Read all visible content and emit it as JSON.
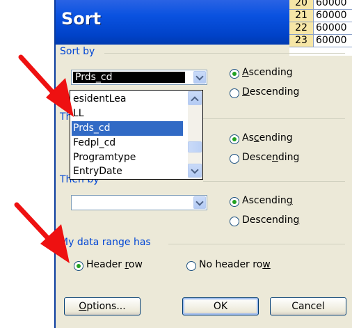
{
  "dialog": {
    "title": "Sort"
  },
  "sheet_rows": [
    {
      "num": "20",
      "val": "60000"
    },
    {
      "num": "21",
      "val": "60000"
    },
    {
      "num": "22",
      "val": "60000"
    },
    {
      "num": "23",
      "val": "60000"
    }
  ],
  "sort_by": {
    "label": "Sort by",
    "selected": "Prds_cd",
    "ascending": {
      "pre": "",
      "ul": "A",
      "post": "scending"
    },
    "descending": {
      "pre": "",
      "ul": "D",
      "post": "escending"
    },
    "order": "ascending"
  },
  "dropdown_list": {
    "items": [
      "ResidentLea",
      "ELL",
      "Prds_cd",
      "Fedpl_cd",
      "Programtype",
      "EntryDate"
    ],
    "visible_items": [
      "esidentLea",
      "LL",
      "Prds_cd",
      "Fedpl_cd",
      "Programtype",
      "EntryDate"
    ],
    "highlighted": "Prds_cd"
  },
  "then_by_1": {
    "label": "Then by",
    "label_visible": "Th",
    "ascending": {
      "pre": "As",
      "ul": "c",
      "post": "ending"
    },
    "descending": {
      "pre": "Desce",
      "ul": "n",
      "post": "ding"
    },
    "order": "ascending"
  },
  "then_by_2": {
    "label": "Then by",
    "label_visible": "Then by",
    "selected": "",
    "ascending": {
      "pre": "Ascendin",
      "ul": "g",
      "post": ""
    },
    "descending": {
      "pre": "Descendin",
      "ul": "g",
      "post": ""
    },
    "order": "ascending"
  },
  "data_range": {
    "label": "My data range has",
    "header_row": {
      "pre": "Header ",
      "ul": "r",
      "post": "ow"
    },
    "no_header_row": {
      "pre": "No header ro",
      "ul": "w",
      "post": ""
    },
    "selected": "header_row"
  },
  "buttons": {
    "options": {
      "pre": "",
      "ul": "O",
      "post": "ptions..."
    },
    "ok": "OK",
    "cancel": "Cancel"
  },
  "colors": {
    "title_bar": "#0a52e0",
    "group_label": "#0046d5",
    "highlight": "#316ac5",
    "annotation_arrow": "#ee1111"
  }
}
